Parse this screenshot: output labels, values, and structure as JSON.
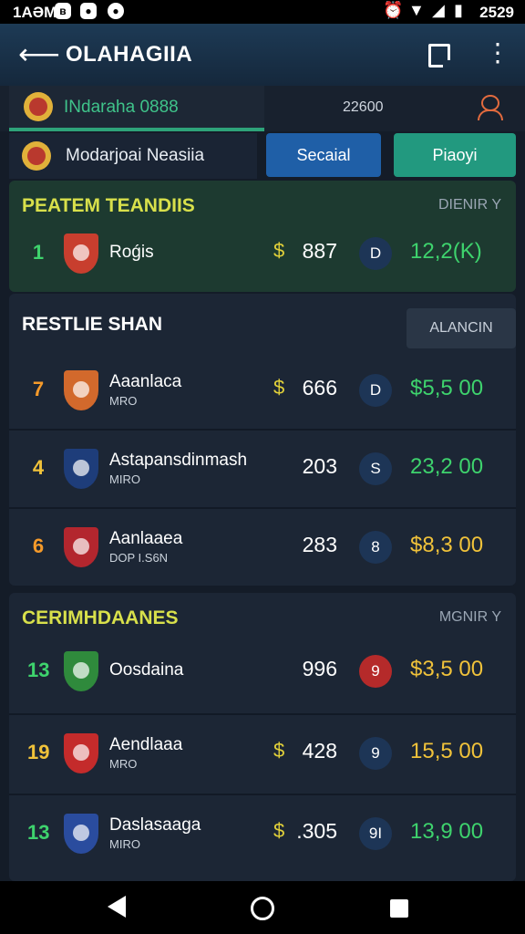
{
  "status": {
    "time": "1AƏM",
    "icon_a": "ʙ",
    "icon_b": "●",
    "icon_c": "●",
    "clock": "2529"
  },
  "app": {
    "title": "OLAHAGIIA"
  },
  "tabs": {
    "primary_label": "INdaraha 0888",
    "middle_value": "22600"
  },
  "row2": {
    "user_label": "Modarjoai Neasiia",
    "blue_button": "Secaial",
    "teal_button": "Piaoyi"
  },
  "sections": [
    {
      "title": "PEATEM TEANDIIS",
      "right_label": "DIENIR Y",
      "title_color": "#d8e04b",
      "rows": [
        {
          "rank": "1",
          "name": "Roǵis",
          "sub": "",
          "dollar": "$",
          "value": "887",
          "circle": "D",
          "money": "12,2(K)",
          "rank_color": "#3ed36d",
          "money_color": "#3ed36d",
          "badge_color": "#c83e2e"
        }
      ]
    },
    {
      "title": "RESTLIE SHAN",
      "right_label": "ALANCIN",
      "title_color": "#ffffff",
      "rows": [
        {
          "rank": "7",
          "name": "Aaanlaca",
          "sub": "MRO",
          "dollar": "$",
          "value": "666",
          "circle": "D",
          "money": "$5,5 00",
          "rank_color": "#f59a2a",
          "money_color": "#3ed36d",
          "badge_color": "#d2692c"
        },
        {
          "rank": "4",
          "name": "Astapansdinmash",
          "sub": "MIRO",
          "dollar": "",
          "value": "203",
          "circle": "S",
          "money": "23,2 00",
          "rank_color": "#f0c23a",
          "money_color": "#3ed36d",
          "badge_color": "#1e3d7a"
        },
        {
          "rank": "6",
          "name": "Aanlaaea",
          "sub": "DOP I.S6N",
          "dollar": "",
          "value": "283",
          "circle": "8",
          "money": "$8,3 00",
          "rank_color": "#f59a2a",
          "money_color": "#f0c23a",
          "badge_color": "#b3262e"
        }
      ]
    },
    {
      "title": "CERIMHDAANES",
      "right_label": "MGNIR Y",
      "title_color": "#d8e04b",
      "rows": [
        {
          "rank": "13",
          "name": "Oosdaina",
          "sub": "",
          "dollar": "",
          "value": "996",
          "circle": "9",
          "money": "$3,5 00",
          "rank_color": "#3ed36d",
          "money_color": "#f0c23a",
          "badge_color": "#2f8a3c",
          "circle_red": true
        },
        {
          "rank": "19",
          "name": "Aendlaaa",
          "sub": "MRO",
          "dollar": "$",
          "value": "428",
          "circle": "9",
          "money": "15,5 00",
          "rank_color": "#f0c23a",
          "money_color": "#f0c23a",
          "badge_color": "#c42b2b"
        },
        {
          "rank": "13",
          "name": "Daslasaaga",
          "sub": "MIRO",
          "dollar": "$",
          "value": ".305",
          "circle": "9I",
          "money": "13,9 00",
          "rank_color": "#3ed36d",
          "money_color": "#3ed36d",
          "badge_color": "#2a4c9e"
        }
      ]
    }
  ]
}
